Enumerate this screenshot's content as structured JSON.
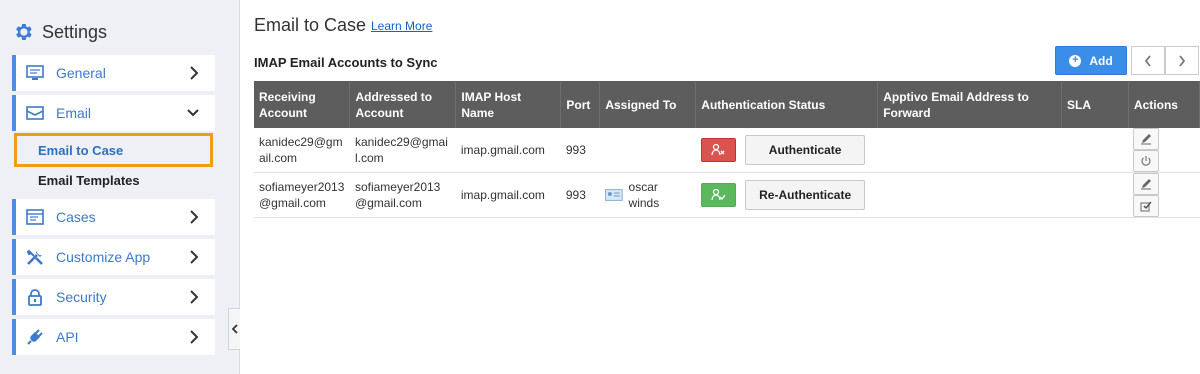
{
  "sidebar": {
    "title": "Settings",
    "items": [
      {
        "label": "General",
        "icon": "monitor-icon"
      },
      {
        "label": "Email",
        "icon": "envelope-icon"
      },
      {
        "label": "Cases",
        "icon": "cases-icon"
      },
      {
        "label": "Customize App",
        "icon": "tools-icon"
      },
      {
        "label": "Security",
        "icon": "lock-icon"
      },
      {
        "label": "API",
        "icon": "plug-icon"
      }
    ],
    "email_subitems": [
      {
        "label": "Email to Case",
        "active": true
      },
      {
        "label": "Email Templates",
        "active": false
      }
    ]
  },
  "header": {
    "title": "Email to Case",
    "learn_more": "Learn More",
    "section_title": "IMAP Email Accounts to Sync",
    "add_label": "Add"
  },
  "table": {
    "columns": [
      "Receiving Account",
      "Addressed to Account",
      "IMAP Host Name",
      "Port",
      "Assigned To",
      "Authentication Status",
      "Apptivo Email Address to Forward",
      "SLA",
      "Actions"
    ],
    "rows": [
      {
        "receiving": "kanidec29@gmail.com",
        "addressed": "kanidec29@gmail.com",
        "host": "imap.gmail.com",
        "port": "993",
        "assigned": "",
        "status_color": "#d9534f",
        "auth_label": "Authenticate",
        "forward": "",
        "sla": ""
      },
      {
        "receiving": "sofiameyer2013@gmail.com",
        "addressed": "sofiameyer2013@gmail.com",
        "host": "imap.gmail.com",
        "port": "993",
        "assigned": "oscar winds",
        "status_color": "#5cb85c",
        "auth_label": "Re-Authenticate",
        "forward": "",
        "sla": ""
      }
    ]
  },
  "colors": {
    "accent": "#3b8ee8",
    "highlight": "#f39c12",
    "header_bg": "#5d5d5d"
  }
}
